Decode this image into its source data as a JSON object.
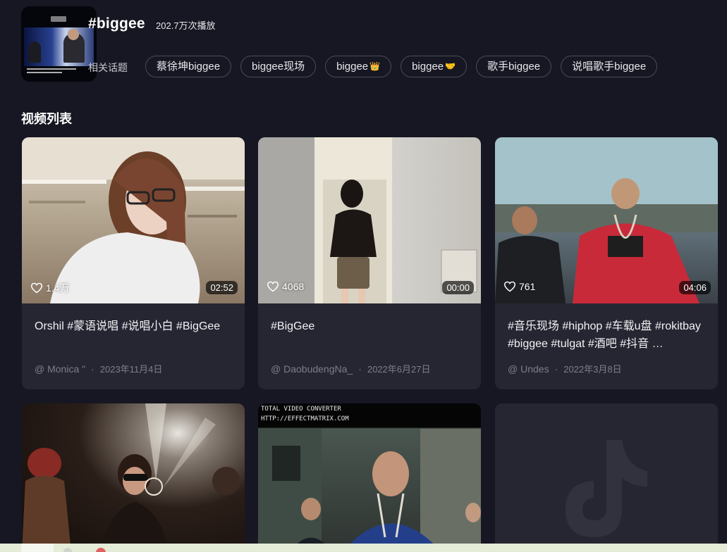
{
  "header": {
    "title": "#biggee",
    "play_count": "202.7万次播放",
    "related_label": "相关话题"
  },
  "related": {
    "topics": [
      {
        "label": "蔡徐坤biggee",
        "emoji": ""
      },
      {
        "label": "biggee现场",
        "emoji": ""
      },
      {
        "label": "biggee",
        "emoji": "👑"
      },
      {
        "label": "biggee",
        "emoji": "🤝"
      },
      {
        "label": "歌手biggee",
        "emoji": ""
      },
      {
        "label": "说唱歌手biggee",
        "emoji": ""
      }
    ]
  },
  "videos": {
    "section_title": "视频列表",
    "items": [
      {
        "likes": "1.4万",
        "duration": "02:52",
        "title": "Orshil #蒙语说唱 #说唱小白 #BigGee",
        "author": "@ Monica \"",
        "date": "2023年11月4日"
      },
      {
        "likes": "4068",
        "duration": "00:00",
        "title": "#BigGee",
        "author": "@ DaobudengNa_",
        "date": "2022年6月27日"
      },
      {
        "likes": "761",
        "duration": "04:06",
        "title": "#音乐现场 #hiphop #车载u盘 #rokitbay #biggee #tulgat #酒吧 #抖音 …",
        "author": "@ Undes",
        "date": "2022年3月8日"
      }
    ],
    "items_row2": [
      {
        "thumb": "concert"
      },
      {
        "thumb": "music-video",
        "overlay_line1": "TOTAL VIDEO CONVERTER",
        "overlay_line2": "HTTP://EFFECTMATRIX.COM"
      },
      {
        "thumb": "placeholder",
        "icon": "tiktok-logo-icon"
      }
    ]
  },
  "colors": {
    "background": "#161722",
    "card": "#252632",
    "chip_border": "#4a4b57",
    "muted_text": "#7d7e88"
  }
}
